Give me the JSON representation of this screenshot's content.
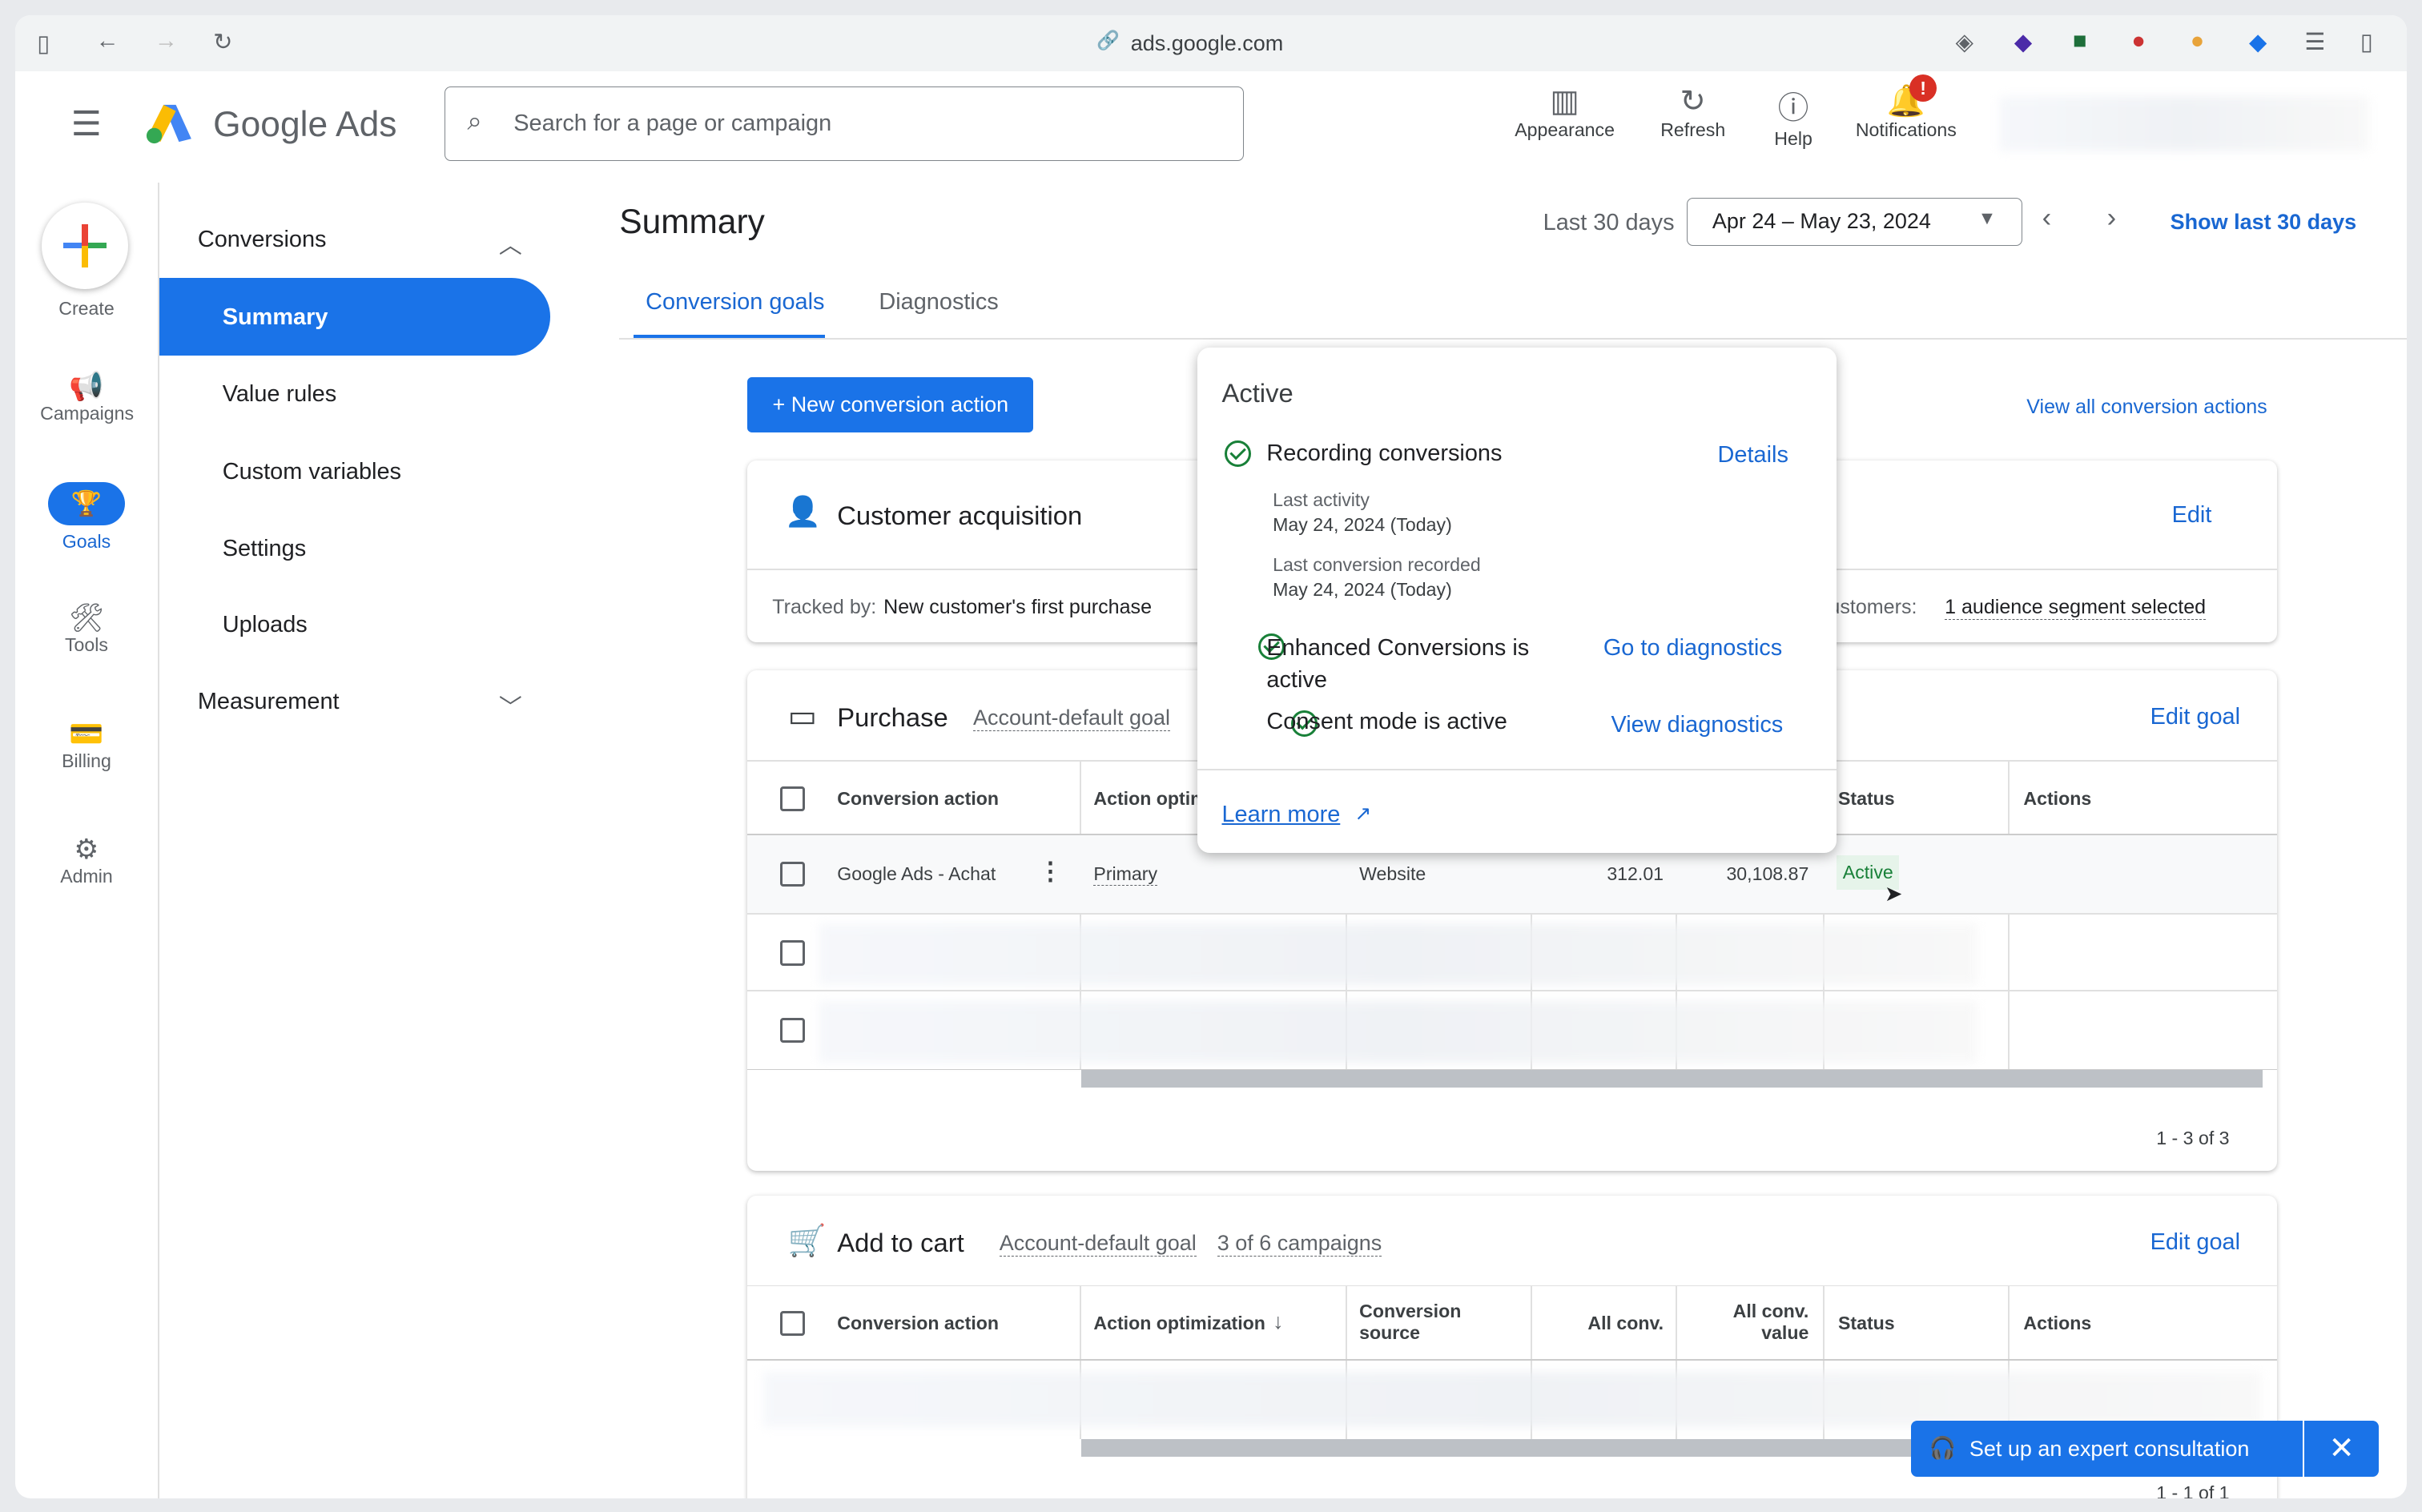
{
  "browser": {
    "url": "ads.google.com"
  },
  "app": {
    "title": "Google Ads",
    "search_placeholder": "Search for a page or campaign"
  },
  "header_actions": [
    {
      "label": "Appearance",
      "icon": "appearance-icon"
    },
    {
      "label": "Refresh",
      "icon": "refresh-icon"
    },
    {
      "label": "Help",
      "icon": "help-icon"
    },
    {
      "label": "Notifications",
      "icon": "bell-icon",
      "badge": "!"
    }
  ],
  "rail": [
    {
      "label": "Create"
    },
    {
      "label": "Campaigns"
    },
    {
      "label": "Goals"
    },
    {
      "label": "Tools"
    },
    {
      "label": "Billing"
    },
    {
      "label": "Admin"
    }
  ],
  "sidebar": {
    "section": "Conversions",
    "items": [
      "Summary",
      "Value rules",
      "Custom variables",
      "Settings",
      "Uploads"
    ],
    "section2": "Measurement"
  },
  "page": {
    "title": "Summary",
    "date_label": "Last 30 days",
    "date_range": "Apr 24 – May 23, 2024",
    "show_last": "Show last 30 days"
  },
  "tabs": [
    "Conversion goals",
    "Diagnostics"
  ],
  "new_action": "+ New conversion action",
  "view_all": "View all conversion actions",
  "customer": {
    "title": "Customer acquisition",
    "edit": "Edit",
    "tracked_label": "Tracked by:",
    "tracked_value": "New customer's first purchase",
    "customers_label": "ustomers:",
    "segment": "1 audience segment selected"
  },
  "purchase": {
    "title": "Purchase",
    "goal": "Account-default goal",
    "edit": "Edit goal",
    "headers": [
      "Conversion action",
      "Action optim",
      "Status",
      "Actions"
    ],
    "row": {
      "name": "Google Ads - Achat",
      "optimization": "Primary",
      "source": "Website",
      "all_conv": "312.01",
      "all_value": "30,108.87",
      "status": "Active"
    },
    "pagination": "1 - 3 of 3"
  },
  "addtocart": {
    "title": "Add to cart",
    "goal": "Account-default goal",
    "campaigns": "3 of 6 campaigns",
    "edit": "Edit goal",
    "headers": [
      "Conversion action",
      "Action optimization",
      "Conversion source",
      "All conv.",
      "All conv. value",
      "Status",
      "Actions"
    ],
    "pagination": "1 - 1 of 1"
  },
  "popup": {
    "title": "Active",
    "recording": "Recording conversions",
    "details": "Details",
    "last_activity_label": "Last activity",
    "last_activity": "May 24, 2024 (Today)",
    "last_conv_label": "Last conversion recorded",
    "last_conv": "May 24, 2024 (Today)",
    "enhanced": "Enhanced Conversions is active",
    "go_diag": "Go to diagnostics",
    "consent": "Consent mode is active",
    "view_diag": "View diagnostics",
    "learn": "Learn more"
  },
  "consult": {
    "label": "Set up an expert consultation"
  },
  "colors": {
    "accent": "#1a73e8",
    "active_green": "#188038"
  }
}
